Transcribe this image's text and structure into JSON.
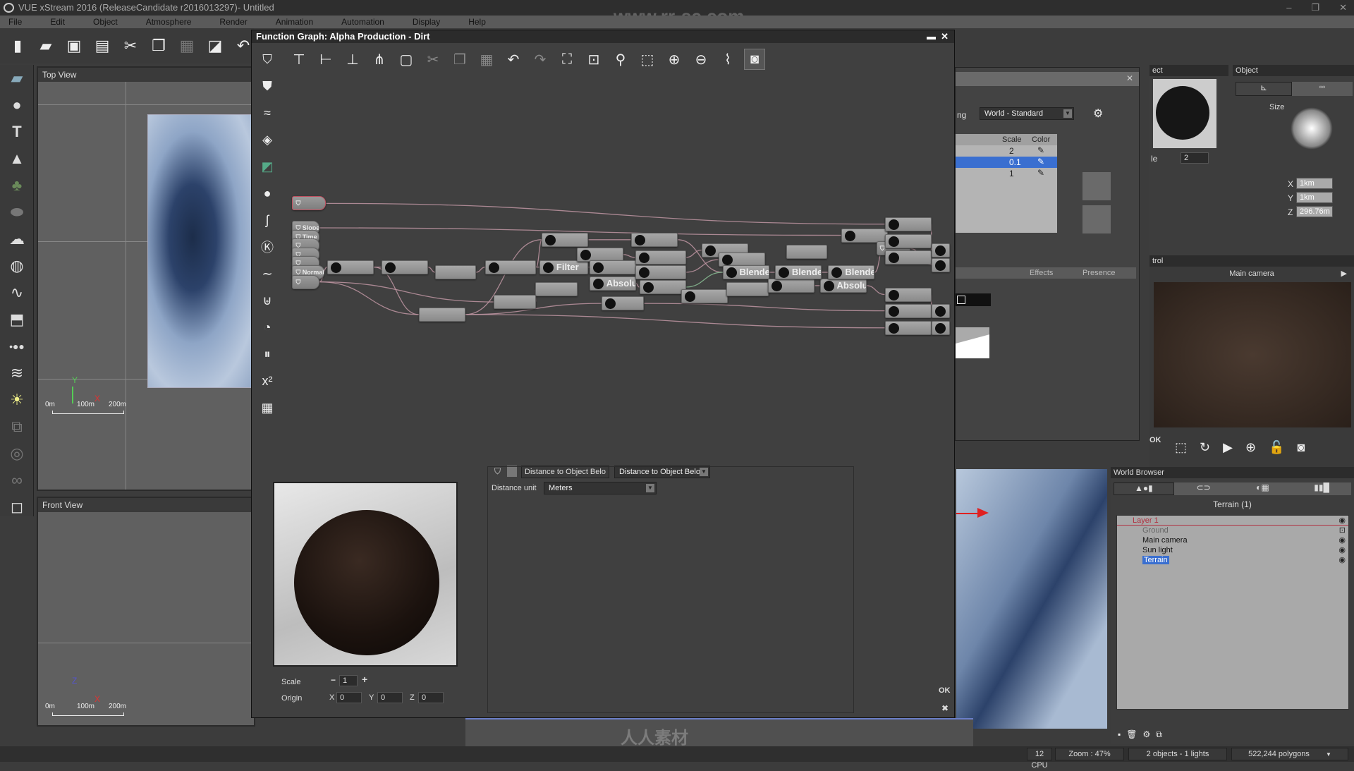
{
  "app": {
    "title": "VUE xStream 2016 (ReleaseCandidate r2016013297)- Untitled",
    "window_controls": [
      "–",
      "❐",
      "✕"
    ]
  },
  "menu": [
    "File",
    "Edit",
    "Object",
    "Atmosphere",
    "Render",
    "Animation",
    "Automation",
    "Display",
    "Help"
  ],
  "toolbar_icons": [
    "new-file-icon",
    "open-icon",
    "save-icon",
    "save-incremental-icon",
    "cut-icon",
    "copy-icon",
    "paste-icon",
    "duplicate-icon",
    "undo-icon"
  ],
  "left_tools": [
    "terrain-icon",
    "sphere-icon",
    "text-icon",
    "mountain-icon",
    "tree-icon",
    "rock-icon",
    "cloud-icon",
    "planet-icon",
    "curve-icon",
    "import-object-icon",
    "ecosystem-icon",
    "wind-icon",
    "light-icon",
    "group-icon",
    "boolean-icon",
    "metablob-icon",
    "load-object-icon"
  ],
  "viewports": {
    "top": {
      "title": "Top View",
      "axis_y": "Y",
      "axis_x": "X",
      "ruler": [
        "0m",
        "100m",
        "200m"
      ]
    },
    "front": {
      "title": "Front View",
      "axis_y": "Z",
      "axis_x": "X",
      "ruler": [
        "0m",
        "100m",
        "200m"
      ]
    }
  },
  "function_graph": {
    "title": "Function Graph: Alpha Production - Dirt",
    "nodes": {
      "n_slope": "Slope",
      "n_time": "Time",
      "n_normal": "Normal",
      "n_filter": "Filter",
      "n_abs1": "Absolute",
      "n_abs2": "Absolute",
      "n_bl1": "Blender",
      "n_bl2": "Blender",
      "n_bl3": "Blender"
    },
    "params": {
      "tab_label": "Distance to Object Belo",
      "node_type": "Distance to Object Below",
      "distance_unit_label": "Distance unit",
      "distance_unit_value": "Meters"
    },
    "preview": {
      "scale_label": "Scale",
      "scale_value": "1",
      "minus": "−",
      "plus": "+",
      "origin_label": "Origin",
      "x_label": "X",
      "x": "0",
      "y_label": "Y",
      "y": "0",
      "z_label": "Z",
      "z": "0"
    },
    "ok": "OK",
    "close": "✖"
  },
  "material_editor": {
    "mapping_label_partial": "ng",
    "mapping_value": "World - Standard",
    "table_headers": [
      "Scale",
      "Color"
    ],
    "rows": [
      {
        "scale": "2",
        "selected": false
      },
      {
        "scale": "0.1",
        "selected": true
      },
      {
        "scale": "1",
        "selected": false
      }
    ],
    "tabs": [
      "Effects",
      "Presence"
    ]
  },
  "object_panel": {
    "left_title_partial": "ect",
    "scale_label_partial": "le",
    "scale_value": "2",
    "title": "Object",
    "size_label": "Size",
    "x_label": "X",
    "x": "1km",
    "y_label": "Y",
    "y": "1km",
    "z_label": "Z",
    "z": "296.76m"
  },
  "camera_control": {
    "title_partial": "trol",
    "camera": "Main camera",
    "ok": "OK"
  },
  "world_browser": {
    "title": "World Browser",
    "filter_label": "Terrain (1)",
    "tree": [
      {
        "label": "Layer 1",
        "level": 0,
        "state": "layer"
      },
      {
        "label": "Ground",
        "level": 1,
        "state": "locked"
      },
      {
        "label": "Main camera",
        "level": 1,
        "state": "normal"
      },
      {
        "label": "Sun light",
        "level": 1,
        "state": "normal"
      },
      {
        "label": "Terrain",
        "level": 1,
        "state": "selected"
      }
    ]
  },
  "status": {
    "cpu": "12 CPU",
    "zoom": "Zoom : 47%",
    "objects": "2 objects - 1 lights",
    "polygons": "522,244 polygons"
  },
  "watermark": {
    "top": "www.rr-sc.com",
    "bottom": "人人素材"
  },
  "colors": {
    "selection": "#3a6fd0",
    "accent_red": "#e02020",
    "wire_pink": "#c59aa8",
    "wire_green": "#8fc79a"
  }
}
